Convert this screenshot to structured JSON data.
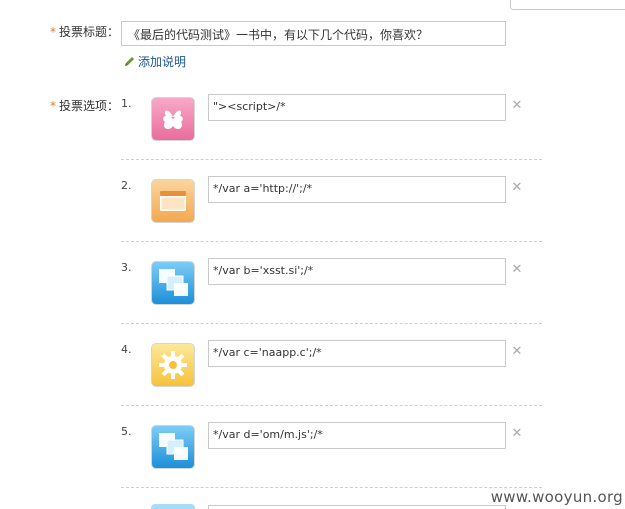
{
  "form": {
    "title_label": "投票标题：",
    "title_required": "*",
    "title_value": "《最后的代码测试》一书中，有以下几个代码，你喜欢？",
    "add_desc_label": "添加说明",
    "options_label": "投票选项：",
    "options_required": "*"
  },
  "options": [
    {
      "num": "1.",
      "value": "\"><script>/*",
      "icon": "heart-clover-icon",
      "color": "#ee7fa7"
    },
    {
      "num": "2.",
      "value": "*/var a='http://';/*",
      "icon": "window-icon",
      "color": "#f4ad5b"
    },
    {
      "num": "3.",
      "value": "*/var b='xsst.si';/*",
      "icon": "stacked-windows-icon",
      "color": "#2e9de0"
    },
    {
      "num": "4.",
      "value": "*/var c='naapp.c';/*",
      "icon": "gear-icon",
      "color": "#f6c84a"
    },
    {
      "num": "5.",
      "value": "*/var d='om/m.js';/*",
      "icon": "stacked-windows-icon",
      "color": "#2e9de0"
    }
  ],
  "watermark": "www.wooyun.org"
}
